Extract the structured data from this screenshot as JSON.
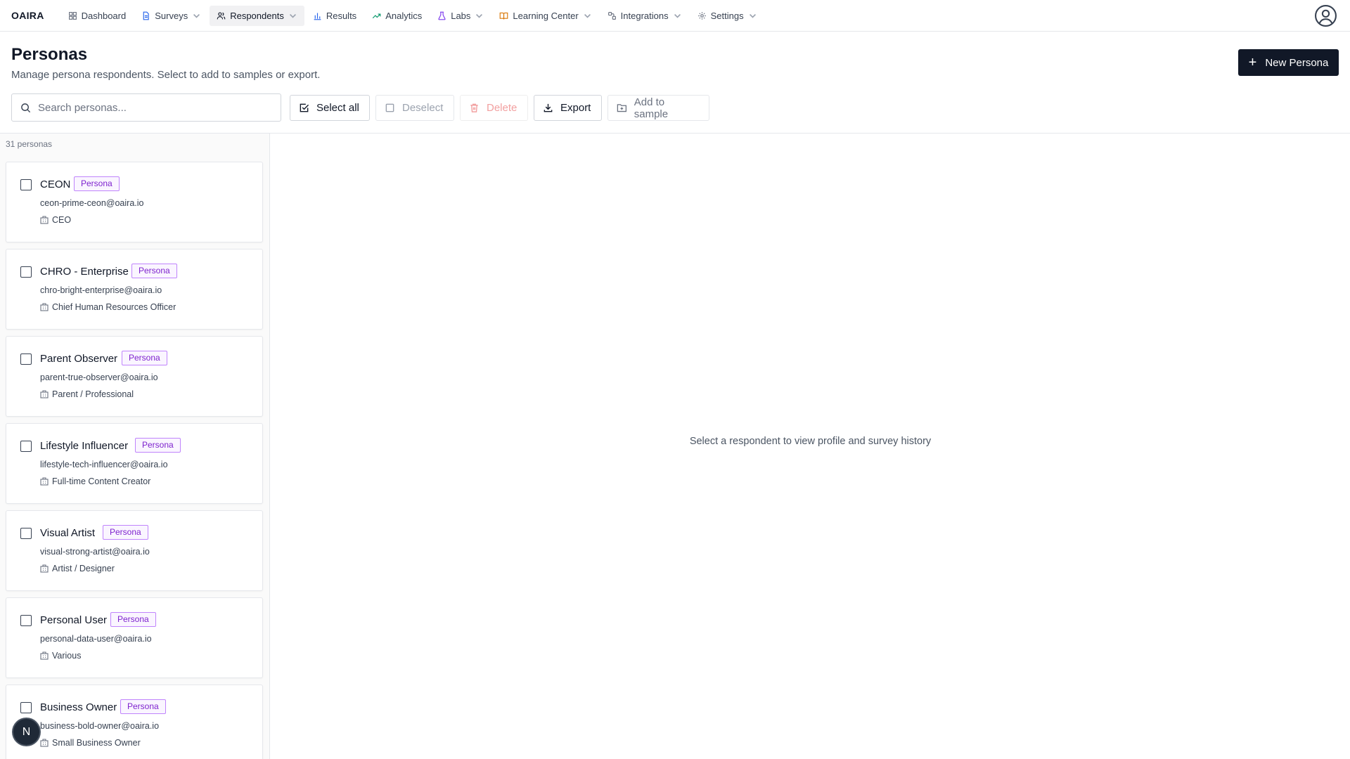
{
  "app": {
    "brand": "OAIRA"
  },
  "nav": {
    "items": [
      {
        "label": "Dashboard",
        "icon": "dashboard-icon",
        "dropdown": false
      },
      {
        "label": "Surveys",
        "icon": "document-icon",
        "dropdown": true
      },
      {
        "label": "Respondents",
        "icon": "users-icon",
        "dropdown": true,
        "active": true
      },
      {
        "label": "Results",
        "icon": "bar-chart-icon",
        "dropdown": false
      },
      {
        "label": "Analytics",
        "icon": "trend-icon",
        "dropdown": false
      },
      {
        "label": "Labs",
        "icon": "flask-icon",
        "dropdown": true
      },
      {
        "label": "Learning Center",
        "icon": "book-icon",
        "dropdown": true
      },
      {
        "label": "Integrations",
        "icon": "plug-icon",
        "dropdown": true
      },
      {
        "label": "Settings",
        "icon": "gear-icon",
        "dropdown": true
      }
    ]
  },
  "header": {
    "title": "Personas",
    "subtitle": "Manage persona respondents. Select to add to samples or export.",
    "new_button": "New Persona"
  },
  "toolbar": {
    "search_placeholder": "Search personas...",
    "select_all": "Select all",
    "deselect": "Deselect",
    "delete": "Delete",
    "export": "Export",
    "add_to_sample": "Add to sample"
  },
  "list": {
    "count_label": "31 personas",
    "badge_label": "Persona",
    "personas": [
      {
        "name": "CEON",
        "email": "ceon-prime-ceon@oaira.io",
        "role": "CEO"
      },
      {
        "name": "CHRO - Enterprise",
        "email": "chro-bright-enterprise@oaira.io",
        "role": "Chief Human Resources Officer"
      },
      {
        "name": "Parent Observer",
        "email": "parent-true-observer@oaira.io",
        "role": "Parent / Professional"
      },
      {
        "name": "Lifestyle Influencer",
        "email": "lifestyle-tech-influencer@oaira.io",
        "role": "Full-time Content Creator"
      },
      {
        "name": "Visual Artist",
        "email": "visual-strong-artist@oaira.io",
        "role": "Artist / Designer"
      },
      {
        "name": "Personal User",
        "email": "personal-data-user@oaira.io",
        "role": "Various"
      },
      {
        "name": "Business Owner",
        "email": "business-bold-owner@oaira.io",
        "role": "Small Business Owner"
      }
    ]
  },
  "detail": {
    "empty_text": "Select a respondent to view profile and survey history"
  },
  "floating": {
    "label": "N"
  },
  "colors": {
    "accent_dark": "#111827",
    "badge_purple": "#7e22ce",
    "delete_red": "#f2a0a0"
  }
}
